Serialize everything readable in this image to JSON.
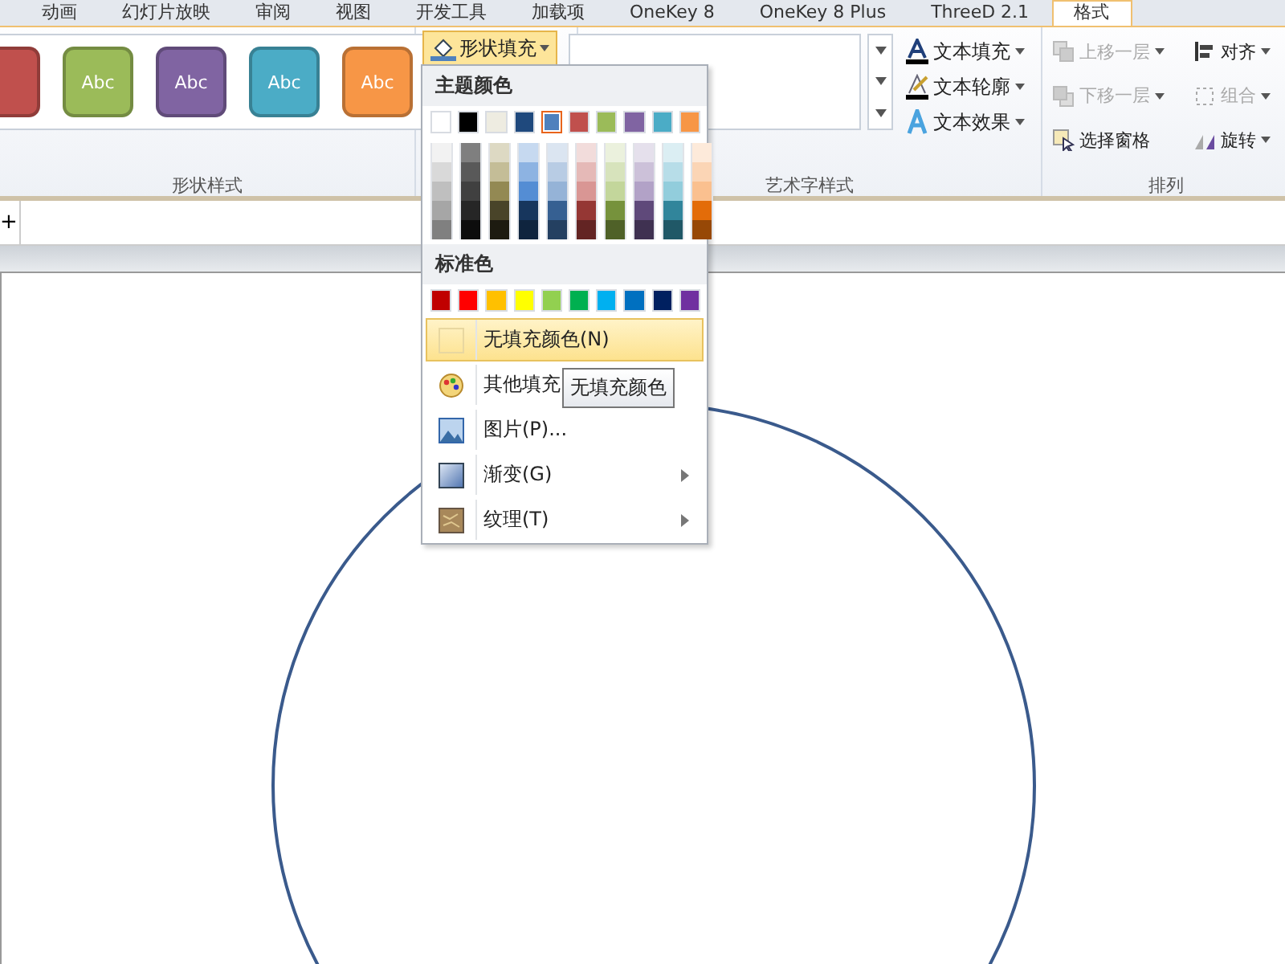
{
  "tabs": [
    {
      "label": "动画",
      "selected": false
    },
    {
      "label": "幻灯片放映",
      "selected": false
    },
    {
      "label": "审阅",
      "selected": false
    },
    {
      "label": "视图",
      "selected": false
    },
    {
      "label": "开发工具",
      "selected": false
    },
    {
      "label": "加载项",
      "selected": false
    },
    {
      "label": "OneKey 8",
      "selected": false
    },
    {
      "label": "OneKey 8 Plus",
      "selected": false
    },
    {
      "label": "ThreeD 2.1",
      "selected": false
    },
    {
      "label": "格式",
      "selected": true
    }
  ],
  "shape_styles": {
    "label": "形状样式",
    "items": [
      {
        "color": "#c0504d"
      },
      {
        "text": "Abc",
        "color": "#9bbb59"
      },
      {
        "text": "Abc",
        "color": "#8064a2"
      },
      {
        "text": "Abc",
        "color": "#4bacc6"
      },
      {
        "text": "Abc",
        "color": "#f79646"
      }
    ]
  },
  "shape_fill_button": {
    "label": "形状填充",
    "expanded": true
  },
  "wordart_styles": {
    "label": "艺术字样式",
    "commands": [
      {
        "label": "文本填充",
        "kind": "fill"
      },
      {
        "label": "文本轮廓",
        "kind": "outline"
      },
      {
        "label": "文本效果",
        "kind": "effect"
      }
    ]
  },
  "arrange": {
    "label": "排列",
    "commands": [
      {
        "label": "上移一层",
        "disabled": true,
        "dropdown": true
      },
      {
        "label": "对齐",
        "disabled": false,
        "dropdown": true
      },
      {
        "label": "下移一层",
        "disabled": true,
        "dropdown": true
      },
      {
        "label": "组合",
        "disabled": true,
        "dropdown": true
      },
      {
        "label": "选择窗格",
        "disabled": false,
        "dropdown": false
      },
      {
        "label": "旋转",
        "disabled": false,
        "dropdown": true
      }
    ]
  },
  "fill_menu": {
    "theme_title": "主题颜色",
    "theme_colors": [
      {
        "color": "#ffffff",
        "selected": false,
        "shades": [
          {
            "color": "#f2f2f2"
          },
          {
            "color": "#d9d9d9"
          },
          {
            "color": "#bfbfbf"
          },
          {
            "color": "#a6a6a6"
          },
          {
            "color": "#808080"
          }
        ]
      },
      {
        "color": "#000000",
        "selected": false,
        "shades": [
          {
            "color": "#7f7f7f"
          },
          {
            "color": "#595959"
          },
          {
            "color": "#404040"
          },
          {
            "color": "#262626"
          },
          {
            "color": "#0d0d0d"
          }
        ]
      },
      {
        "color": "#eeece1",
        "selected": false,
        "shades": [
          {
            "color": "#ddd9c3"
          },
          {
            "color": "#c4bd97"
          },
          {
            "color": "#938953"
          },
          {
            "color": "#494429"
          },
          {
            "color": "#1d1b10"
          }
        ]
      },
      {
        "color": "#1f497d",
        "selected": false,
        "shades": [
          {
            "color": "#c6d9f0"
          },
          {
            "color": "#8db3e2"
          },
          {
            "color": "#548dd4"
          },
          {
            "color": "#17365d"
          },
          {
            "color": "#0f243e"
          }
        ]
      },
      {
        "color": "#4f81bd",
        "selected": true,
        "shades": [
          {
            "color": "#dbe5f1"
          },
          {
            "color": "#b8cce4"
          },
          {
            "color": "#95b3d7"
          },
          {
            "color": "#366092"
          },
          {
            "color": "#244061"
          }
        ]
      },
      {
        "color": "#c0504d",
        "selected": false,
        "shades": [
          {
            "color": "#f2dcdb"
          },
          {
            "color": "#e5b9b7"
          },
          {
            "color": "#d99694"
          },
          {
            "color": "#953734"
          },
          {
            "color": "#632423"
          }
        ]
      },
      {
        "color": "#9bbb59",
        "selected": false,
        "shades": [
          {
            "color": "#ebf1dd"
          },
          {
            "color": "#d7e3bc"
          },
          {
            "color": "#c3d69b"
          },
          {
            "color": "#76923c"
          },
          {
            "color": "#4f6128"
          }
        ]
      },
      {
        "color": "#8064a2",
        "selected": false,
        "shades": [
          {
            "color": "#e5e0ec"
          },
          {
            "color": "#ccc1d9"
          },
          {
            "color": "#b2a2c7"
          },
          {
            "color": "#5f497a"
          },
          {
            "color": "#3f3151"
          }
        ]
      },
      {
        "color": "#4bacc6",
        "selected": false,
        "shades": [
          {
            "color": "#dbeef3"
          },
          {
            "color": "#b7dde8"
          },
          {
            "color": "#92cddc"
          },
          {
            "color": "#31859b"
          },
          {
            "color": "#205867"
          }
        ]
      },
      {
        "color": "#f79646",
        "selected": false,
        "shades": [
          {
            "color": "#fdeada"
          },
          {
            "color": "#fbd5b5"
          },
          {
            "color": "#fac08f"
          },
          {
            "color": "#e36c09"
          },
          {
            "color": "#974806"
          }
        ]
      }
    ],
    "standard_title": "标准色",
    "standard_colors": [
      {
        "color": "#c00000"
      },
      {
        "color": "#ff0000"
      },
      {
        "color": "#ffc000"
      },
      {
        "color": "#ffff00"
      },
      {
        "color": "#92d050"
      },
      {
        "color": "#00b050"
      },
      {
        "color": "#00b0f0"
      },
      {
        "color": "#0070c0"
      },
      {
        "color": "#002060"
      },
      {
        "color": "#7030a0"
      }
    ],
    "items": [
      {
        "label": "无填充颜色(N)",
        "kind": "none",
        "selected": true,
        "submenu": false
      },
      {
        "label": "其他填充",
        "kind": "palette",
        "selected": false,
        "submenu": false
      },
      {
        "label": "图片(P)...",
        "kind": "picture",
        "selected": false,
        "submenu": false
      },
      {
        "label": "渐变(G)",
        "kind": "gradient",
        "selected": false,
        "submenu": true
      },
      {
        "label": "纹理(T)",
        "kind": "texture",
        "selected": false,
        "submenu": true
      }
    ]
  },
  "tooltip": "无填充颜色",
  "ruler_mark": "+"
}
